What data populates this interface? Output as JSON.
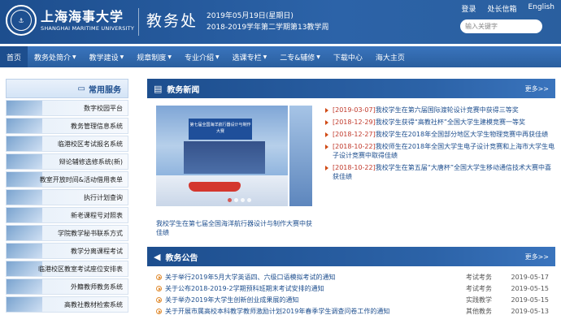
{
  "header": {
    "logo_text": "上海海事大学",
    "university_cn": "上海海事大学",
    "university_en": "SHANGHAI MARITIME UNIVERSITY",
    "department": "教务处",
    "date_line": "2019年05月19日(星期日)",
    "term_line": "2018-2019学年第二学期第13教学周",
    "top_links": [
      "登录",
      "处长信箱",
      "English"
    ],
    "search_placeholder": "输入关键字"
  },
  "nav": {
    "items": [
      {
        "label": "首页",
        "caret": false
      },
      {
        "label": "教务处简介",
        "caret": true
      },
      {
        "label": "教学建设",
        "caret": true
      },
      {
        "label": "规章制度",
        "caret": true
      },
      {
        "label": "专业介绍",
        "caret": true
      },
      {
        "label": "选课专栏",
        "caret": true
      },
      {
        "label": "二专&辅修",
        "caret": true
      },
      {
        "label": "下载中心",
        "caret": false
      },
      {
        "label": "海大主页",
        "caret": false
      }
    ]
  },
  "sidebar": {
    "title": "常用服务",
    "items": [
      "数字校园平台",
      "教务管理信息系统",
      "临港校区考试报名系统",
      "辩论辅修选修系统(新)",
      "教室开放时间&活动借用表单",
      "执行计划查询",
      "新老课程号对照表",
      "学院教学秘书联系方式",
      "教学分离课程考试",
      "临港校区教室考试座位安排表",
      "外籍教师教务系统",
      "高教社教材检索系统"
    ]
  },
  "news": {
    "title": "教务新闻",
    "more": "更多>>",
    "photo_banner": "第七届全国海洋航行器设计与制作大赛",
    "caption": "我校学生在第七届全国海洋航行器设计与制作大赛中获佳绩",
    "items": [
      {
        "date": "[2019-03-07]",
        "text": "我校学生在第六届国际渡轮设计竞赛中获得三等奖"
      },
      {
        "date": "[2018-12-29]",
        "text": "我校学生获得“高教社杯”全国大学生建模竞赛一等奖"
      },
      {
        "date": "[2018-12-27]",
        "text": "我校学生在2018年全国部分地区大学生物理竞赛中再获佳绩"
      },
      {
        "date": "[2018-10-22]",
        "text": "我校师生在2018年全国大学生电子设计竞赛和上海市大学生电子设计竞赛中取得佳绩"
      },
      {
        "date": "[2018-10-22]",
        "text": "我校学生在第五届“大唐杯”全国大学生移动通信技术大赛中喜获佳绩"
      }
    ]
  },
  "announcements": {
    "title": "教务公告",
    "more": "更多>>",
    "items": [
      {
        "title": "关于举行2019年5月大学英语四、六级口语模拟考试的通知",
        "category": "考试考务",
        "date": "2019-05-17"
      },
      {
        "title": "关于公布2018-2019-2学期预科班期末考试安排的通知",
        "category": "考试考务",
        "date": "2019-05-15"
      },
      {
        "title": "关于举办2019年大学生创新创业成果展的通知",
        "category": "实践教学",
        "date": "2019-05-15"
      },
      {
        "title": "关于开展市属高校本科教学教师激励计划2019年春季学生调查问卷工作的通知",
        "category": "其他教务",
        "date": "2019-05-13"
      }
    ]
  }
}
